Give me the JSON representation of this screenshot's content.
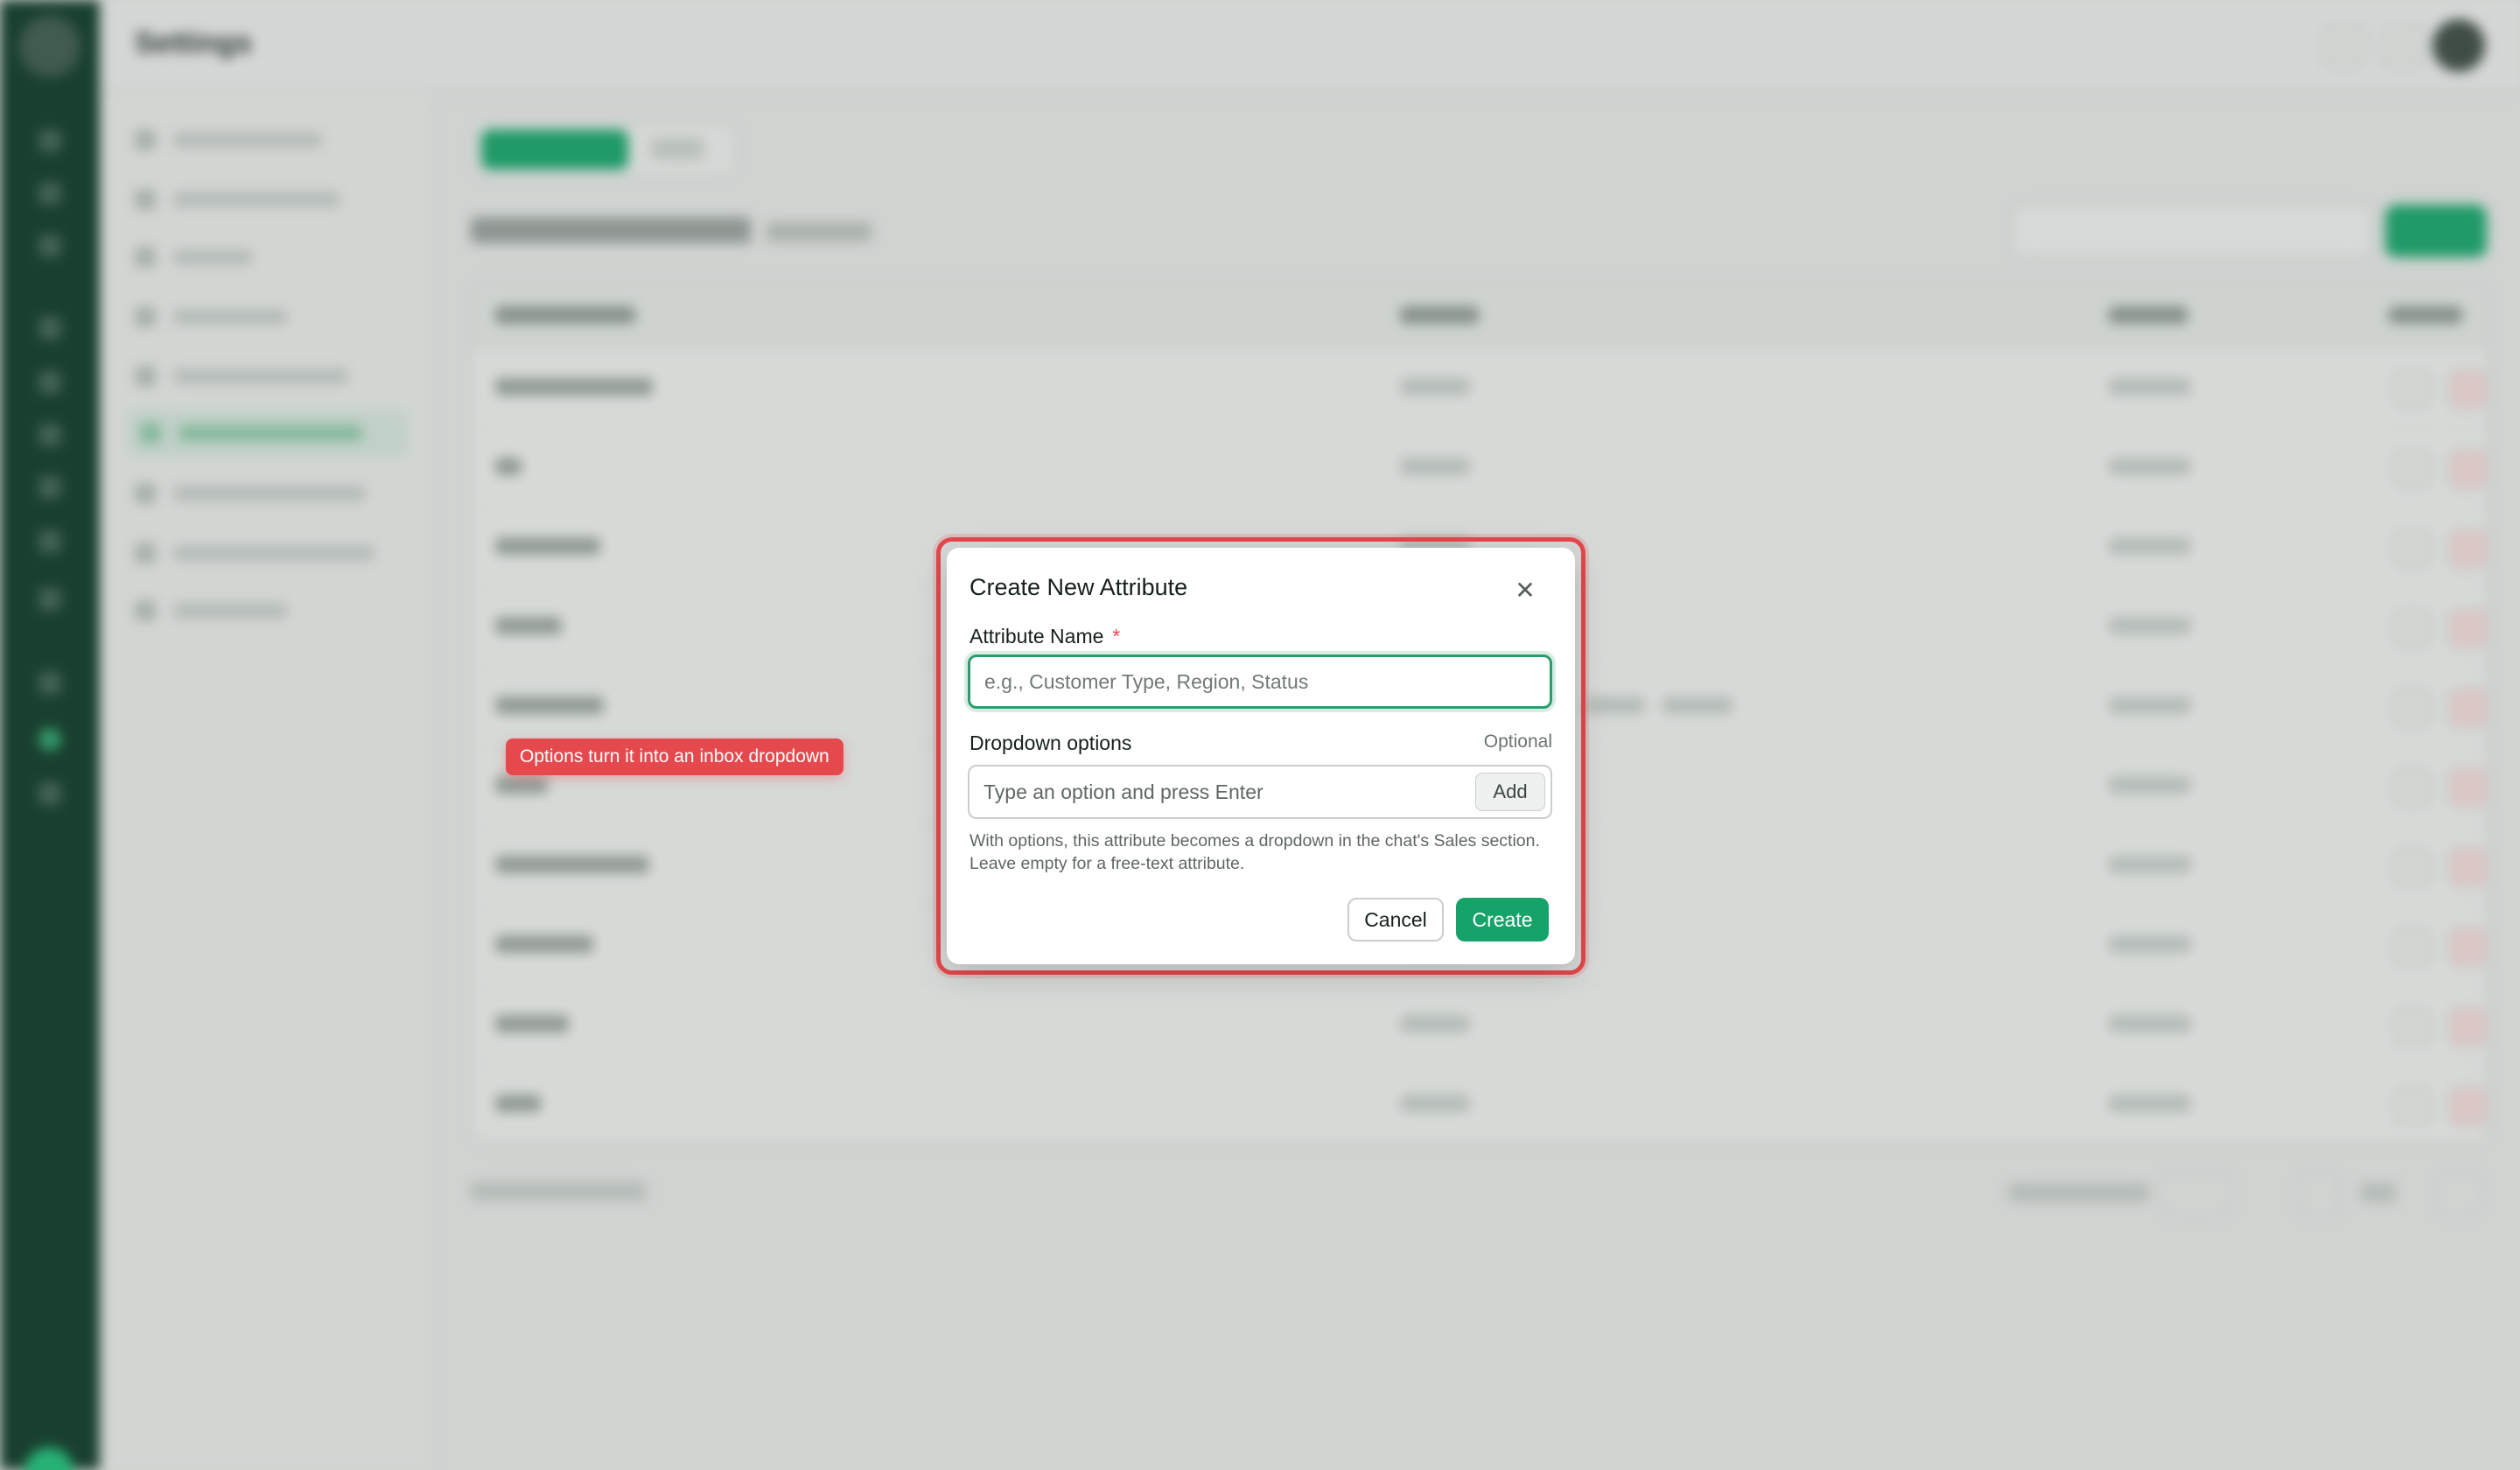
{
  "header": {
    "title": "Settings"
  },
  "modal": {
    "title": "Create New Attribute",
    "close_glyph": "✕",
    "attribute_name": {
      "label": "Attribute Name",
      "required_mark": "*",
      "value": "",
      "placeholder": "e.g., Customer Type, Region, Status"
    },
    "dropdown_options": {
      "label": "Dropdown options",
      "optional_label": "Optional",
      "value": "",
      "placeholder": "Type an option and press Enter",
      "add_label": "Add",
      "help_text": "With options, this attribute becomes a dropdown in the chat's Sales section. Leave empty for a free-text attribute."
    },
    "cancel_label": "Cancel",
    "create_label": "Create"
  },
  "tooltip": {
    "text": "Options turn it into an inbox dropdown"
  },
  "colors": {
    "accent": "#16a36a",
    "highlight": "#e5484d",
    "rail": "#0e3a28"
  },
  "icons": [
    "close-icon"
  ]
}
